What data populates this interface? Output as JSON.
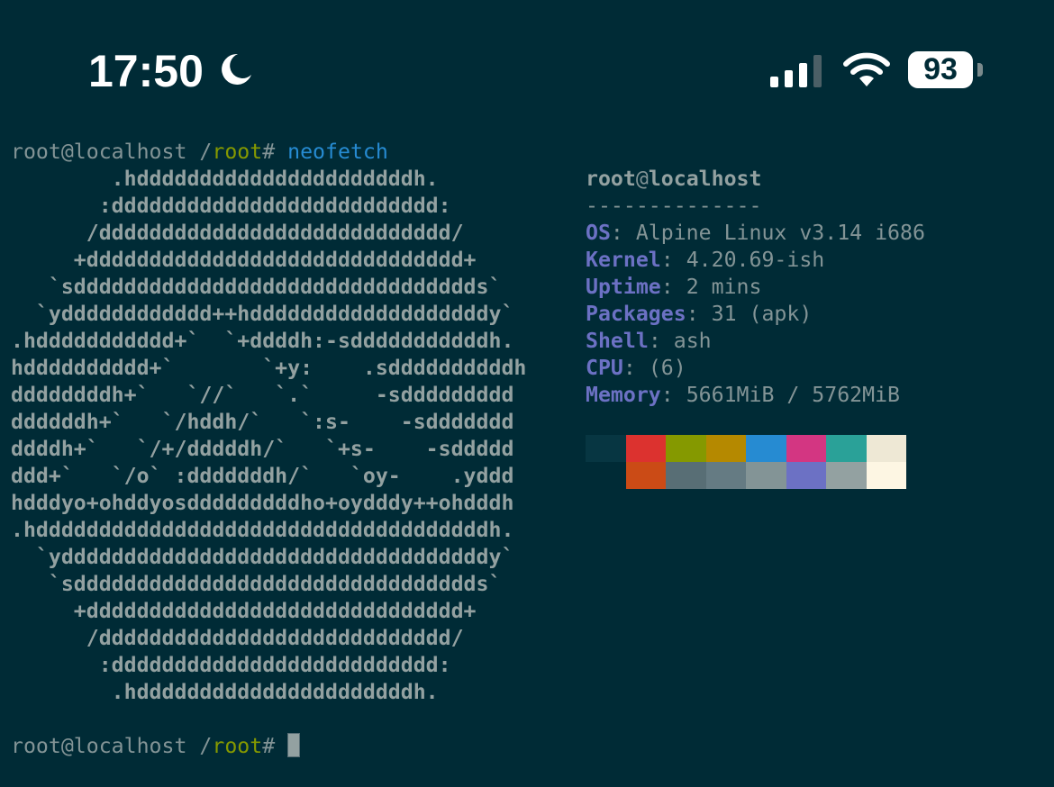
{
  "status_bar": {
    "time": "17:50",
    "battery_level": "93",
    "icons": [
      "moon-icon",
      "cellular-signal-icon",
      "wifi-icon",
      "battery-icon"
    ]
  },
  "terminal": {
    "prompt_user_host": "root@localhost",
    "prompt_path_prefix": " /",
    "prompt_path_dir": "root",
    "prompt_symbol": "# ",
    "command": "neofetch",
    "logo_lines": [
      "        .hddddddddddddddddddddddh.",
      "       :dddddddddddddddddddddddddd:",
      "      /dddddddddddddddddddddddddddd/",
      "     +dddddddddddddddddddddddddddddd+",
      "   `sdddddddddddddddddddddddddddddddds`",
      "  `ydddddddddddd++hdddddddddddddddddddy`",
      ".hddddddddddd+`  `+ddddh:-sdddddddddddh.",
      "hdddddddddd+`       `+y:    .sddddddddddh",
      "ddddddddh+`   `//`   `.`     -sddddddddd",
      "ddddddh+`   `/hddh/`   `:s-    -sddddddd",
      "ddddh+`   `/+/dddddh/`   `+s-    -sddddd",
      "ddd+`   `/o` :dddddddh/`   `oy-    .yddd",
      "hdddyo+ohddyosdddddddddho+oydddy++ohdddh",
      ".hddddddddddddddddddddddddddddddddddddh.",
      "  `yddddddddddddddddddddddddddddddddddy`",
      "   `sdddddddddddddddddddddddddddddddds`",
      "     +dddddddddddddddddddddddddddddd+",
      "      /dddddddddddddddddddddddddddd/",
      "       :dddddddddddddddddddddddddd:",
      "        .hddddddddddddddddddddddh."
    ],
    "info": {
      "user": "root",
      "at": "@",
      "host": "localhost",
      "separator": "--------------",
      "fields": [
        {
          "label": "OS",
          "colon": ": ",
          "value": "Alpine Linux v3.14 i686"
        },
        {
          "label": "Kernel",
          "colon": ": ",
          "value": "4.20.69-ish"
        },
        {
          "label": "Uptime",
          "colon": ": ",
          "value": "2 mins"
        },
        {
          "label": "Packages",
          "colon": ": ",
          "value": "31 (apk)"
        },
        {
          "label": "Shell",
          "colon": ": ",
          "value": "ash"
        },
        {
          "label": "CPU",
          "colon": ": ",
          "value": "(6)"
        },
        {
          "label": "Memory",
          "colon": ": ",
          "value": "5661MiB / 5762MiB"
        }
      ]
    },
    "palette_row1": [
      "#073642",
      "#dc322f",
      "#859900",
      "#b58900",
      "#268bd2",
      "#d33682",
      "#2aa198",
      "#eee8d5"
    ],
    "palette_row2": [
      "#002b36",
      "#cb4b16",
      "#586e75",
      "#657b83",
      "#839496",
      "#6c71c4",
      "#93a1a1",
      "#fdf6e3"
    ]
  }
}
